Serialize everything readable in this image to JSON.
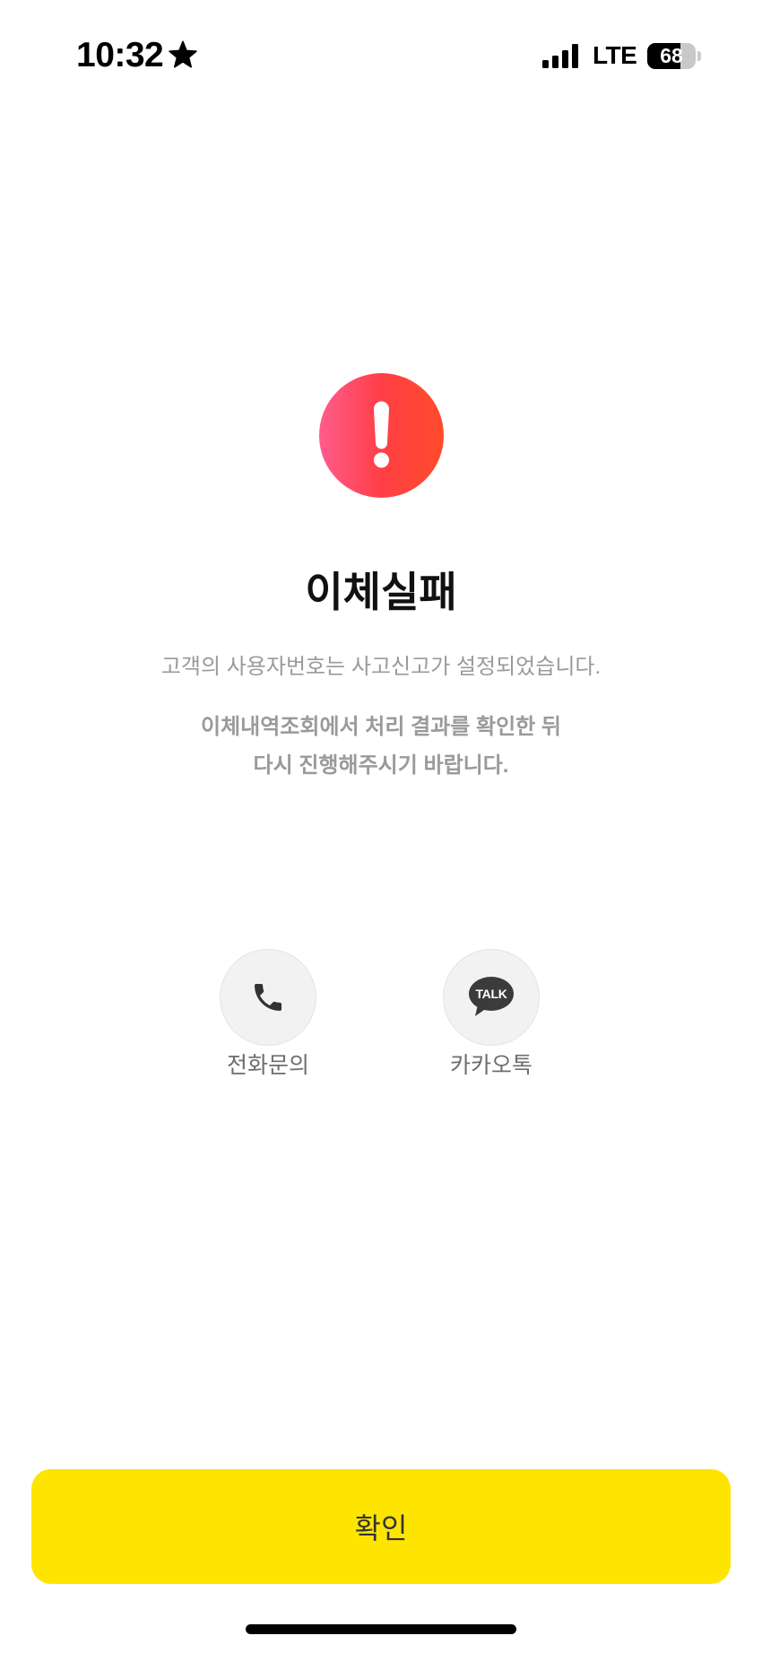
{
  "status_bar": {
    "time": "10:32",
    "time_icon": "star-icon",
    "signal_icon": "cellular-signal-icon",
    "network": "LTE",
    "battery": "68",
    "battery_icon": "battery-icon"
  },
  "alert": {
    "icon": "exclamation-circle-icon"
  },
  "result": {
    "title": "이체실패",
    "message": "고객의 사용자번호는 사고신고가 설정되었습니다.",
    "instruction_lines": [
      "이체내역조회에서 처리 결과를 확인한 뒤",
      "다시 진행해주시기 바랍니다."
    ]
  },
  "contact_options": [
    {
      "label": "전화문의",
      "icon": "phone-icon"
    },
    {
      "label": "카카오톡",
      "icon": "kakaotalk-icon",
      "icon_text": "TALK"
    }
  ],
  "confirm_button": {
    "label": "확인"
  },
  "colors": {
    "accent": "#FEE500",
    "alert_start": "#FF5C8D",
    "alert_end": "#FF4B2B",
    "title": "#111111",
    "secondary_text": "#9A9A9A"
  }
}
